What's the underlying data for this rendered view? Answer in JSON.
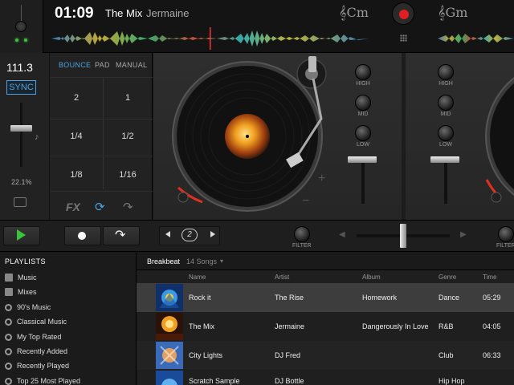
{
  "header": {
    "time": "01:09",
    "track_title": "The Mix",
    "track_artist": "Jermaine",
    "key_left": "𝄞Cm",
    "key_right": "𝄞Gm"
  },
  "deck": {
    "bpm": "111.3",
    "sync_label": "SYNC",
    "pitch_percent": "22.1%",
    "pitch_fader_level": 0.55,
    "tabs": [
      {
        "label": "BOUNCE",
        "active": true
      },
      {
        "label": "PAD",
        "active": false
      },
      {
        "label": "MANUAL",
        "active": false
      }
    ],
    "loop_values": [
      "2",
      "1",
      "1/4",
      "1/2",
      "1/8",
      "1/16"
    ],
    "fx_label": "FX"
  },
  "mixer": {
    "eq_labels": [
      "HIGH",
      "MID",
      "LOW"
    ],
    "filter_label": "FILTER",
    "crossfader_level": 0.5,
    "plus_sign": "+",
    "minus_sign": "−"
  },
  "transport": {
    "beat_count": "2"
  },
  "playlists": {
    "header": "PLAYLISTS",
    "items": [
      {
        "label": "Music",
        "icon": "music-note-icon"
      },
      {
        "label": "Mixes",
        "icon": "music-note-icon"
      },
      {
        "label": "90's Music",
        "icon": "gear-icon"
      },
      {
        "label": "Classical Music",
        "icon": "gear-icon"
      },
      {
        "label": "My Top Rated",
        "icon": "gear-icon"
      },
      {
        "label": "Recently Added",
        "icon": "gear-icon"
      },
      {
        "label": "Recently Played",
        "icon": "gear-icon"
      },
      {
        "label": "Top 25 Most Played",
        "icon": "gear-icon"
      }
    ]
  },
  "library": {
    "crate_name": "Breakbeat",
    "song_count": "14 Songs",
    "columns": [
      "Name",
      "Artist",
      "Album",
      "Genre",
      "Time"
    ],
    "rows": [
      {
        "name": "Rock it",
        "artist": "The Rise",
        "album": "Homework",
        "genre": "Dance",
        "time": "05:29",
        "selected": true
      },
      {
        "name": "The Mix",
        "artist": "Jermaine",
        "album": "Dangerously In Love",
        "genre": "R&B",
        "time": "04:05",
        "selected": false
      },
      {
        "name": "City Lights",
        "artist": "DJ Fred",
        "album": "",
        "genre": "Club",
        "time": "06:33",
        "selected": false
      },
      {
        "name": "Scratch Sample",
        "artist": "DJ Bottle",
        "album": "",
        "genre": "Hip Hop",
        "time": "",
        "selected": false
      }
    ]
  },
  "colors": {
    "accent": "#4aa3e0",
    "play_green": "#3ac43a",
    "record_red": "#e02020"
  }
}
